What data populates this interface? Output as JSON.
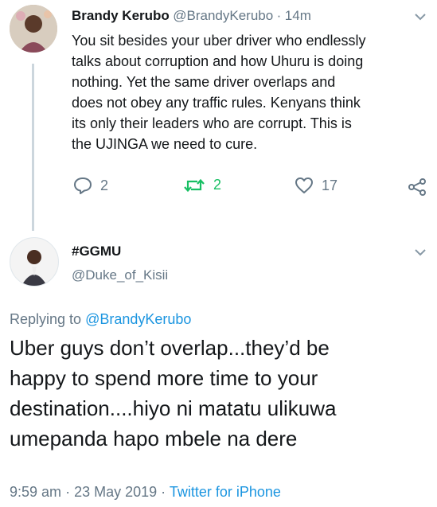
{
  "tweet1": {
    "name": "Brandy Kerubo",
    "handle": "@BrandyKerubo",
    "sep": "·",
    "time": "14m",
    "text_lines": [
      "You sit besides your uber driver who endlessly",
      "talks about corruption and how Uhuru is doing",
      "nothing. Yet the same driver overlaps and",
      "does not obey any traffic rules. Kenyans think",
      "its only their leaders who are corrupt. This is",
      "the UJINGA we need to cure."
    ],
    "replies": "2",
    "retweets": "2",
    "likes": "17"
  },
  "tweet2": {
    "name": "#GGMU",
    "handle": "@Duke_of_Kisii",
    "replying_prefix": "Replying to",
    "replying_handle": "@BrandyKerubo",
    "text_lines": [
      "Uber guys don’t overlap...they’d be",
      "happy to spend more time to your",
      "destination....hiyo ni matatu ulikuwa",
      "umepanda hapo mbele na dere"
    ],
    "time": "9:59 am",
    "sep1": "·",
    "date": "23 May 2019",
    "sep2": "·",
    "source": "Twitter for iPhone"
  },
  "colors": {
    "text": "#14171a",
    "secondary": "#657786",
    "link": "#1b95e0",
    "retweet": "#17bf63",
    "thread_line": "#ccd6dd"
  },
  "icons": [
    "reply-icon",
    "retweet-icon",
    "like-icon",
    "share-icon",
    "chevron-down-icon"
  ]
}
